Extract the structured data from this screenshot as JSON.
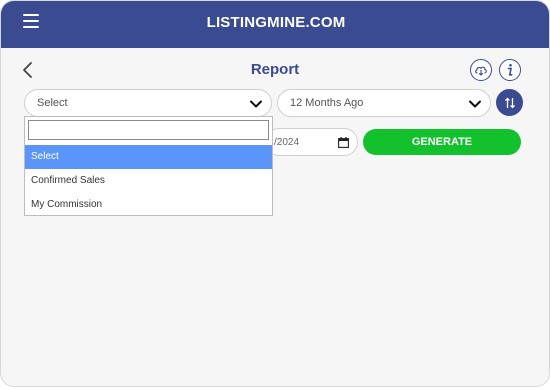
{
  "header": {
    "brand": "LISTINGMINE.COM"
  },
  "page": {
    "title": "Report"
  },
  "filters": {
    "report_select": {
      "value": "Select"
    },
    "period_select": {
      "value": "12 Months Ago"
    },
    "date_value": "/2024",
    "generate_label": "GENERATE"
  },
  "dropdown": {
    "search_value": "",
    "options": [
      {
        "label": "Select",
        "selected": true
      },
      {
        "label": "Confirmed Sales",
        "selected": false
      },
      {
        "label": "My Commission",
        "selected": false
      }
    ]
  },
  "colors": {
    "brand": "#3a4b92",
    "generate": "#13c12d",
    "option_highlight": "#5b95f9",
    "background": "#f6f6f6"
  },
  "icons": [
    "menu-icon",
    "back-arrow-icon",
    "cloud-download-icon",
    "info-icon",
    "chevron-down-icon",
    "sort-icon",
    "calendar-icon"
  ]
}
